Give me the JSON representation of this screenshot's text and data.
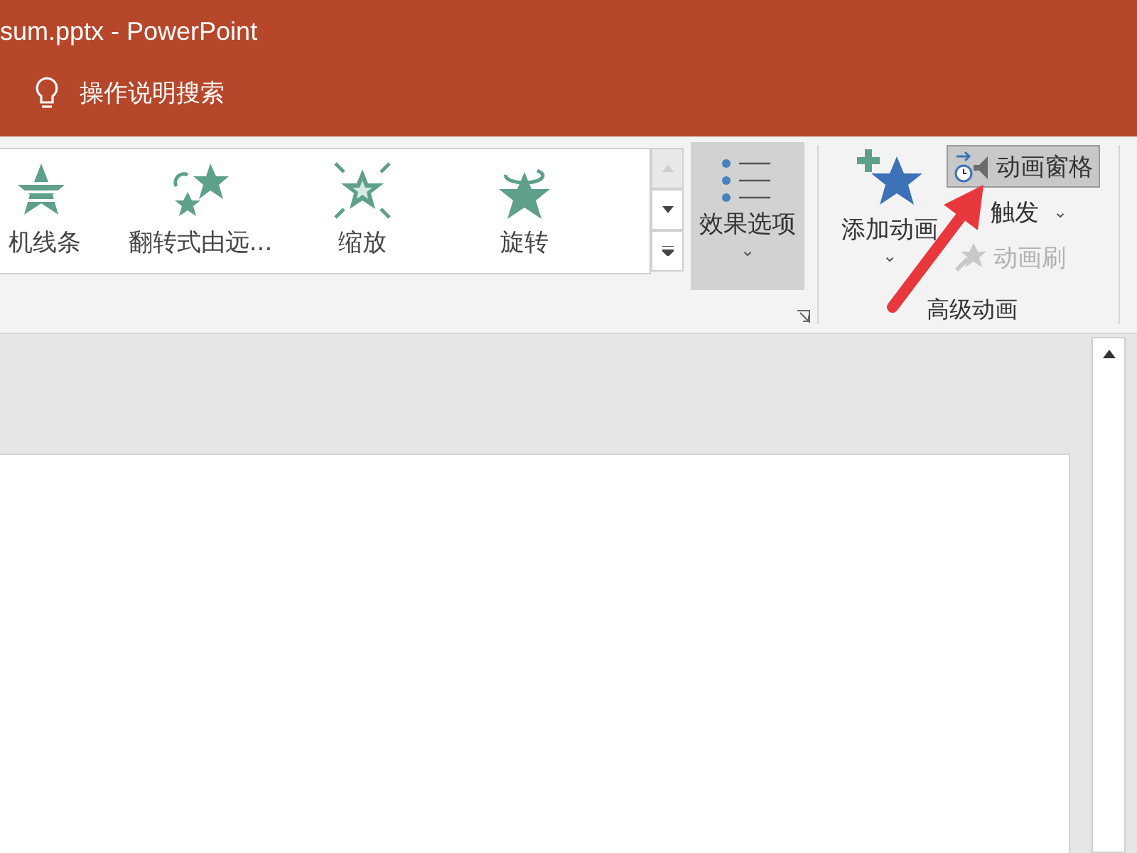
{
  "window": {
    "title": "sum.pptx  -  PowerPoint"
  },
  "tell_me": {
    "placeholder": "操作说明搜索"
  },
  "gallery": {
    "items": [
      {
        "label": "机线条",
        "kind": "stripes"
      },
      {
        "label": "翻转式由远...",
        "kind": "flip"
      },
      {
        "label": "缩放",
        "kind": "zoom"
      },
      {
        "label": "旋转",
        "kind": "spin"
      }
    ]
  },
  "effect_options": {
    "label": "效果选项",
    "caret": "⌄",
    "selected": true
  },
  "advanced": {
    "add_animation": {
      "label": "添加动画",
      "caret": "⌄"
    },
    "buttons": [
      {
        "label": "动画窗格",
        "kind": "pane",
        "selected": true,
        "disabled": false
      },
      {
        "label": "触发",
        "kind": "trigger",
        "caret": "⌄",
        "selected": false,
        "disabled": false
      },
      {
        "label": "动画刷",
        "kind": "painter",
        "selected": false,
        "disabled": true
      }
    ],
    "group_label": "高级动画"
  }
}
